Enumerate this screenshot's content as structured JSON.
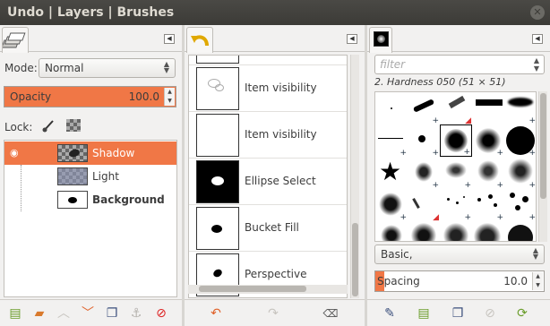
{
  "window": {
    "title": "Undo | Layers | Brushes",
    "close_glyph": "✕"
  },
  "layers": {
    "mode_label": "Mode:",
    "mode_value": "Normal",
    "opacity_label": "Opacity",
    "opacity_value": "100.0",
    "lock_label": "Lock:",
    "rows": [
      {
        "name": "Shadow",
        "selected": true,
        "visible": true
      },
      {
        "name": "Light",
        "selected": false,
        "visible": false
      },
      {
        "name": "Background",
        "selected": false,
        "visible": false,
        "bold": true
      }
    ]
  },
  "undo": {
    "items": [
      {
        "label": ""
      },
      {
        "label": "Item visibility"
      },
      {
        "label": "Item visibility"
      },
      {
        "label": "Ellipse Select"
      },
      {
        "label": "Bucket Fill"
      },
      {
        "label": "Perspective"
      }
    ]
  },
  "brushes": {
    "filter_placeholder": "filter",
    "selected_brush": "2. Hardness 050 (51 × 51)",
    "preset_value": "Basic,",
    "spacing_label": "Spacing",
    "spacing_value": "10.0"
  },
  "colors": {
    "accent": "#f07746",
    "titlebar": "#3c3b37"
  }
}
